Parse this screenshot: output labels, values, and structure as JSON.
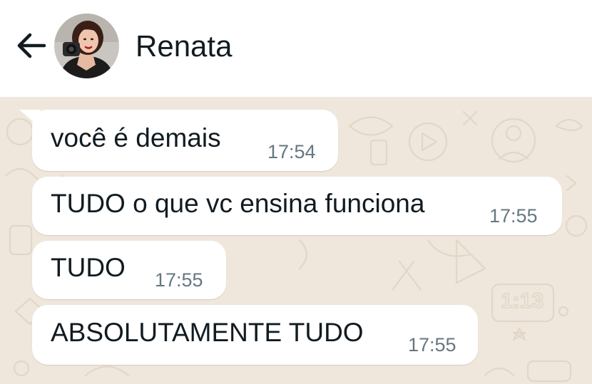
{
  "header": {
    "back_icon": "arrow-left-icon",
    "contact_name": "Renata"
  },
  "chat": {
    "wallpaper_color": "#efe7dc",
    "bubble_color": "#ffffff",
    "messages": [
      {
        "text": "você é demais",
        "time": "17:54"
      },
      {
        "text": "TUDO o que vc ensina funciona",
        "time": "17:55"
      },
      {
        "text": "TUDO",
        "time": "17:55"
      },
      {
        "text": "ABSOLUTAMENTE TUDO",
        "time": "17:55"
      }
    ]
  }
}
